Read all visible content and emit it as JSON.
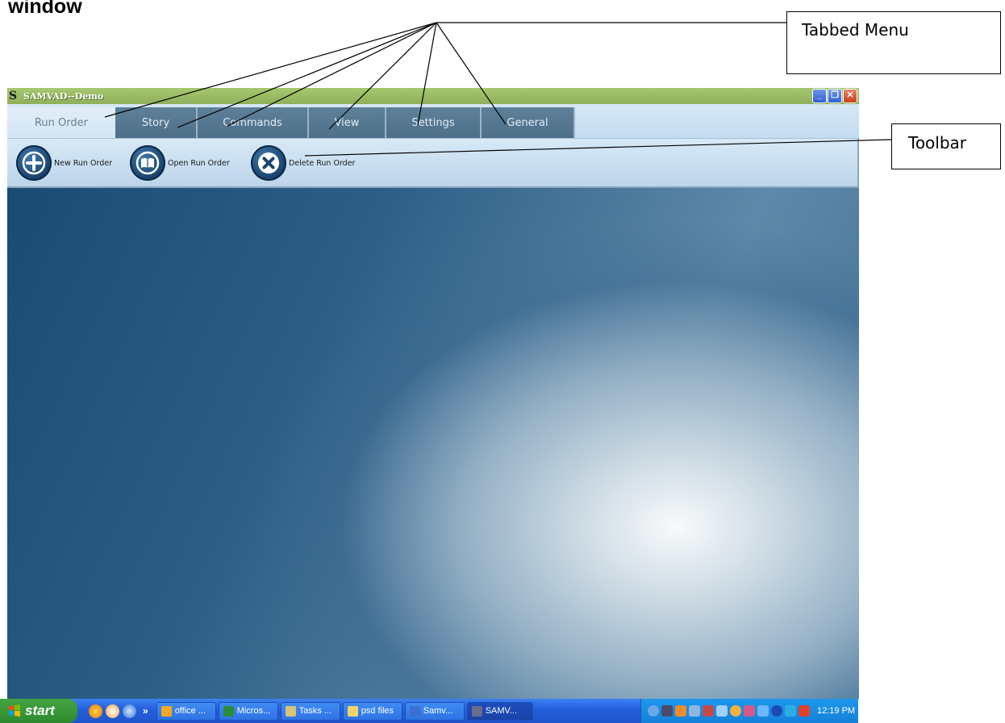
{
  "document": {
    "heading": "window",
    "callouts": {
      "tabbed_menu": "Tabbed Menu",
      "toolbar": "Toolbar"
    }
  },
  "window": {
    "title": "SAMVAD--Demo",
    "controls": [
      "minimize",
      "restore",
      "close"
    ]
  },
  "tabs": [
    {
      "label": "Run Order",
      "active": true
    },
    {
      "label": "Story",
      "active": false
    },
    {
      "label": "Commands",
      "active": false
    },
    {
      "label": "View",
      "active": false
    },
    {
      "label": "Settings",
      "active": false
    },
    {
      "label": "General",
      "active": false
    }
  ],
  "toolbar": {
    "buttons": [
      {
        "label": "New Run Order",
        "icon": "plus-icon"
      },
      {
        "label": "Open Run Order",
        "icon": "book-icon"
      },
      {
        "label": "Delete Run Order",
        "icon": "x-icon"
      }
    ]
  },
  "taskbar": {
    "start_label": "start",
    "quick_launch_more": "»",
    "tasks": [
      {
        "label": "office ...",
        "icon_color": "#f5a623"
      },
      {
        "label": "Micros...",
        "icon_color": "#2e8b3a"
      },
      {
        "label": "Tasks ...",
        "icon_color": "#d9c27a"
      },
      {
        "label": "psd files",
        "icon_color": "#f3d36b"
      },
      {
        "label": "Samv...",
        "icon_color": "#3b6fd1"
      },
      {
        "label": "SAMV...",
        "icon_color": "#6b6b8a",
        "active": true
      }
    ],
    "clock": "12:19 PM"
  },
  "colors": {
    "titlebar": "#9bbd63",
    "tab_inactive": "#557790",
    "tab_active": "#dbeaf6",
    "toolbar": "#c8dff0",
    "workspace_dark": "#1a4b72",
    "taskbar": "#245edb"
  }
}
